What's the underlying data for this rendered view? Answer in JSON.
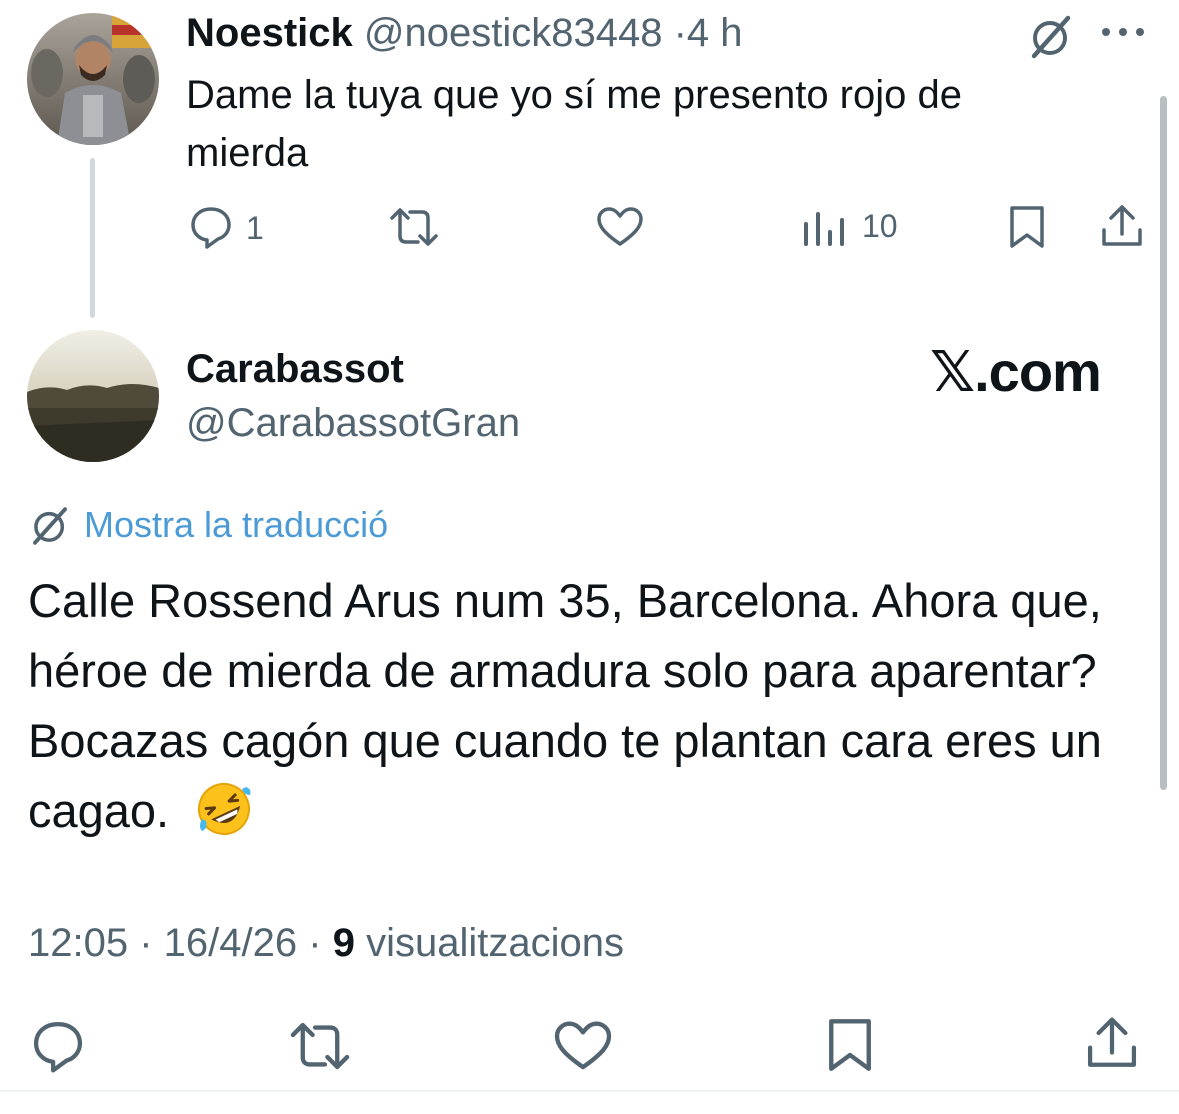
{
  "reply": {
    "author_name": "Noestick",
    "author_handle": "@noestick83448",
    "separator": "·",
    "time": "4 h",
    "text": "Dame la tuya que yo sí me presento rojo de mierda",
    "replies_count": "1",
    "views_count": "10"
  },
  "main_tweet": {
    "author_name": "Carabassot",
    "author_handle": "@CarabassotGran",
    "brand_watermark": "𝕏.com",
    "translate_label": "Mostra la traducció",
    "text": "Calle Rossend Arus num 35, Barcelona. Ahora que, héroe de mierda de armadura solo para aparentar? Bocazas cagón que cuando te plantan cara eres un cagao.",
    "time": "12:05",
    "date": "16/4/26",
    "views_count": "9",
    "views_label": "visualitzacions"
  },
  "colors": {
    "text_primary": "#0f1419",
    "text_secondary": "#536471",
    "link": "#1d9bf0",
    "thread_line": "#cfd9de"
  },
  "icons": [
    "grok-icon",
    "more-icon",
    "reply-icon",
    "retweet-icon",
    "like-icon",
    "views-icon",
    "bookmark-icon",
    "share-icon",
    "translate-icon",
    "emoji-rofl-icon"
  ]
}
